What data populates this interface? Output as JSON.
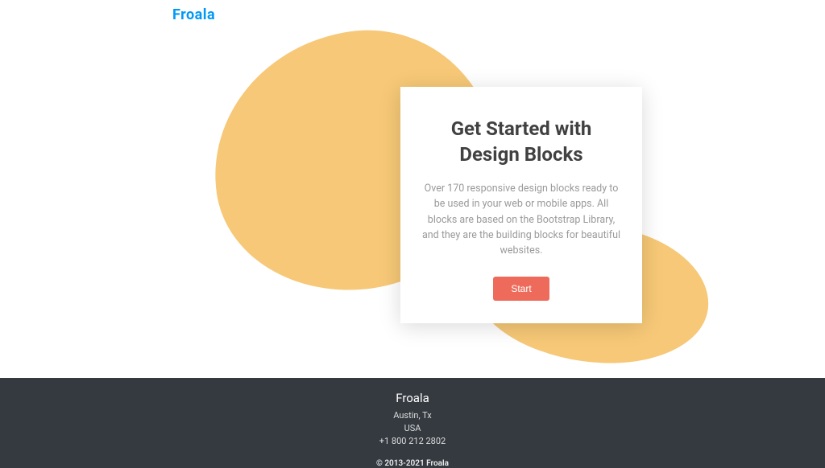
{
  "logo": "Froala",
  "hero": {
    "title": "Get Started with Design Blocks",
    "description": "Over 170 responsive design blocks ready to be used in your web or mobile apps. All blocks are based on the Bootstrap Library, and they are the building blocks for beautiful websites.",
    "button": "Start"
  },
  "footer": {
    "brand": "Froala",
    "city": "Austin, Tx",
    "country": "USA",
    "phone": "+1 800 212 2802",
    "copyright": "© 2013-2021 Froala"
  }
}
